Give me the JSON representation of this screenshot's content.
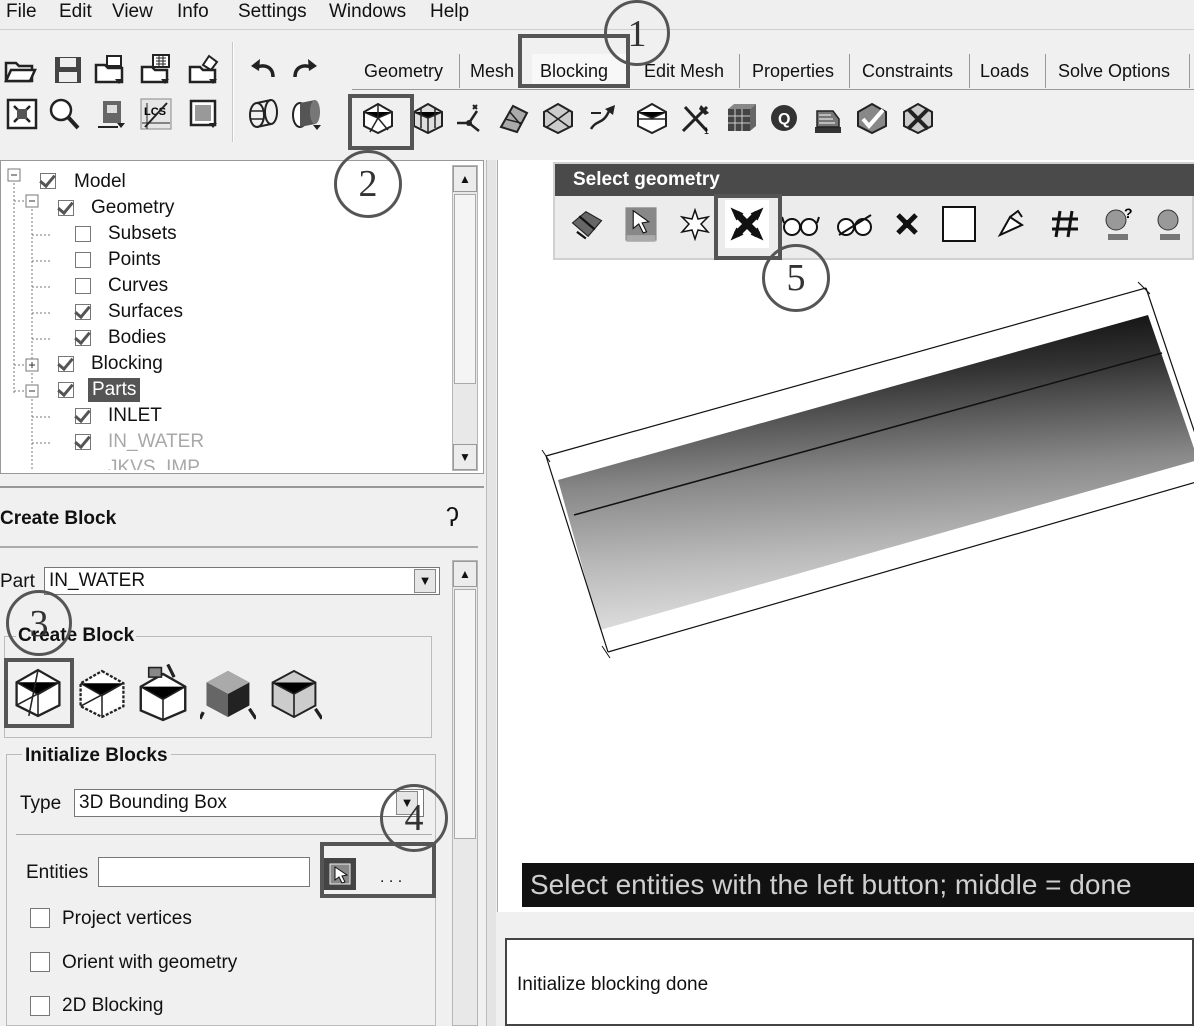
{
  "menu": [
    "File",
    "Edit",
    "View",
    "Info",
    "Settings",
    "Windows",
    "Help"
  ],
  "tabs": [
    "Geometry",
    "Mesh",
    "Blocking",
    "Edit Mesh",
    "Properties",
    "Constraints",
    "Loads",
    "Solve Options"
  ],
  "active_tab": "Blocking",
  "tree": {
    "model": "Model",
    "geometry": "Geometry",
    "subsets": "Subsets",
    "points": "Points",
    "curves": "Curves",
    "surfaces": "Surfaces",
    "bodies": "Bodies",
    "blocking": "Blocking",
    "parts": "Parts",
    "inlet": "INLET",
    "in_water": "IN_WATER",
    "cut_off": "JKVS_IMP"
  },
  "create_block_panel": {
    "title": "Create Block",
    "part_label": "Part",
    "part_value": "IN_WATER",
    "section_title": "Create Block",
    "init_title": "Initialize Blocks",
    "type_label": "Type",
    "type_value": "3D Bounding Box",
    "entities_label": "Entities",
    "entities_value": "",
    "ellipsis": ". . .",
    "project_vertices": "Project vertices",
    "orient_with_geometry": "Orient with geometry",
    "blocking_2d": "2D Blocking"
  },
  "select_geometry": {
    "title": "Select geometry"
  },
  "status_message": "Select entities with the left button; middle = done",
  "log_text": "Initialize blocking done",
  "annotations": [
    "1",
    "2",
    "3",
    "4",
    "5"
  ],
  "icons": {
    "toolbar_left": [
      "open-folder-icon",
      "save-icon",
      "open-geometry-icon",
      "save-geometry-icon",
      "import-icon",
      "undo-icon",
      "redo-icon",
      "fit-window-icon",
      "zoom-icon",
      "measure-icon",
      "lcs-icon",
      "refresh-icon",
      "wireframe-icon",
      "solid-icon"
    ],
    "blocking_toolbar": [
      "create-block-icon",
      "split-block-icon",
      "vertex-icon",
      "associate-icon",
      "edit-block-icon",
      "transform-icon",
      "edge-params-icon",
      "pre-mesh-icon",
      "block-checks-icon",
      "delete-block-icon"
    ]
  }
}
